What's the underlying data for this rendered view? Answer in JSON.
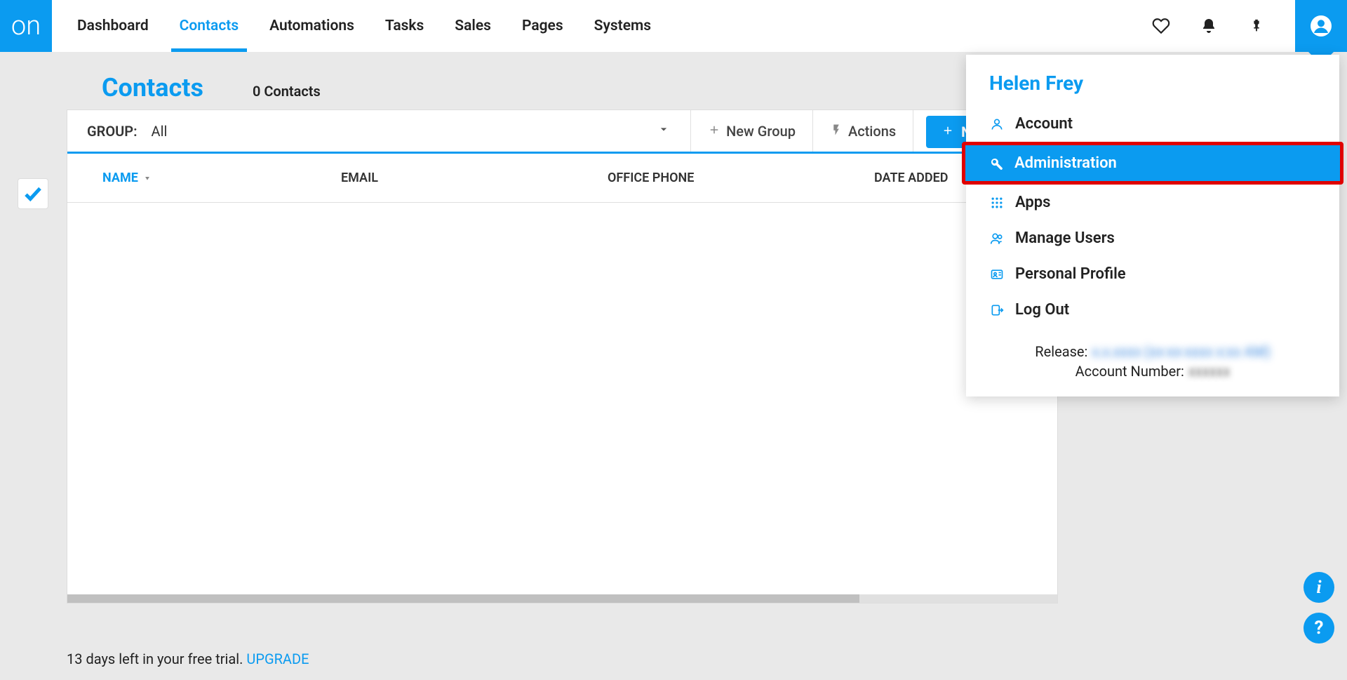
{
  "brand": {
    "logo_text": "on"
  },
  "nav": {
    "items": [
      "Dashboard",
      "Contacts",
      "Automations",
      "Tasks",
      "Sales",
      "Pages",
      "Systems"
    ],
    "active_index": 1
  },
  "page": {
    "title": "Contacts",
    "subtitle": "0 Contacts"
  },
  "toolbar": {
    "group_label": "GROUP:",
    "group_value": "All",
    "new_group": "New Group",
    "actions": "Actions",
    "new_contact": "New Contact"
  },
  "table": {
    "cols": {
      "name": "NAME",
      "email": "EMAIL",
      "phone": "OFFICE PHONE",
      "date": "DATE ADDED"
    }
  },
  "profile_menu": {
    "user_name": "Helen Frey",
    "items": [
      {
        "icon": "user",
        "label": "Account"
      },
      {
        "icon": "wrench",
        "label": "Administration",
        "selected": true
      },
      {
        "icon": "apps",
        "label": "Apps"
      },
      {
        "icon": "users",
        "label": "Manage Users"
      },
      {
        "icon": "idcard",
        "label": "Personal Profile"
      },
      {
        "icon": "logout",
        "label": "Log Out"
      }
    ],
    "release_label": "Release:",
    "release_value": "x.x.xxxx (xx-xx-xxxx x:xx AM)",
    "account_label": "Account Number:",
    "account_value": "xxxxxx"
  },
  "trial": {
    "text": "13 days left in your free trial. ",
    "upgrade": "UPGRADE"
  }
}
